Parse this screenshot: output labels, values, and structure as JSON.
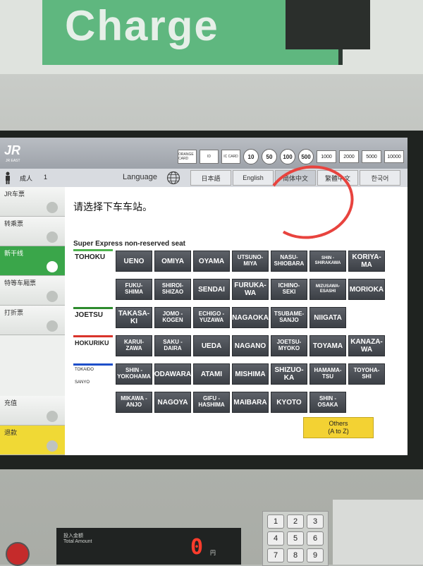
{
  "sign": {
    "text": "Charge"
  },
  "topbar": {
    "logo": "JR",
    "logo_sub": "JR EAST",
    "payment": {
      "cards": [
        "ORANGE CARD",
        "ID",
        "IC CARD"
      ],
      "coins": [
        "10",
        "50",
        "100",
        "500"
      ],
      "notes": [
        "1000",
        "2000",
        "5000",
        "10000"
      ]
    }
  },
  "langbar": {
    "passenger_label": "成人",
    "passenger_count": "1",
    "language_label": "Language",
    "tabs": [
      "日本語",
      "English",
      "简体中文",
      "繁體中文",
      "한국어"
    ]
  },
  "sidebar": {
    "items": [
      {
        "label": "JR车票",
        "state": "normal"
      },
      {
        "label": "转乘票",
        "state": "normal"
      },
      {
        "label": "新干线",
        "state": "active"
      },
      {
        "label": "特等车厢票",
        "state": "normal"
      },
      {
        "label": "打折票",
        "state": "normal"
      },
      {
        "label": "充值",
        "state": "normal"
      },
      {
        "label": "退款",
        "state": "highlight"
      }
    ]
  },
  "main": {
    "prompt": "请选择下车车站。",
    "seat_type": "Super Express non-reserved seat",
    "lines": [
      {
        "name": "TOHOKU",
        "color": "#4db34d"
      },
      {
        "name": "JOETSU",
        "color": "#2e8b2e"
      },
      {
        "name": "HOKURIKU",
        "color": "#d9342b"
      },
      {
        "name": "TOKAIDO",
        "color": "#1e4fc9"
      },
      {
        "name": "SANYO",
        "color": "#1e4fc9"
      }
    ],
    "stations": [
      [
        "UENO",
        "OMIYA",
        "OYAMA",
        "UTSUNO-\nMIYA",
        "NASU-\nSHIOBARA",
        "SHIN -\nSHIRAKAWA",
        "KORIYA-\nMA"
      ],
      [
        "FUKU-\nSHIMA",
        "SHIROI-\nSHIZAO",
        "SENDAI",
        "FURUKA-\nWA",
        "ICHINO-\nSEKI",
        "MIZUSAWA-\nESASHI",
        "MORIOKA"
      ],
      [
        "TAKASA-\nKI",
        "JOMO -\nKOGEN",
        "ECHIGO -\nYUZAWA",
        "NAGAOKA",
        "TSUBAME-\nSANJO",
        "NIIGATA"
      ],
      [
        "KARUI-\nZAWA",
        "SAKU -\nDAIRA",
        "UEDA",
        "NAGANO",
        "JOETSU-\nMYOKO",
        "TOYAMA",
        "KANAZA-\nWA"
      ],
      [
        "SHIN -\nYOKOHAMA",
        "ODAWARA",
        "ATAMI",
        "MISHIMA",
        "SHIZUO-\nKA",
        "HAMAMA-\nTSU",
        "TOYOHA-\nSHI"
      ],
      [
        "MIKAWA -\nANJO",
        "NAGOYA",
        "GIFU -\nHASHIMA",
        "MAIBARA",
        "KYOTO",
        "SHIN -\nOSAKA"
      ]
    ],
    "others": "Others\n(A to Z)"
  },
  "bottom": {
    "amount_label": "投入金額\nTotal Amount",
    "amount_value": "0",
    "amount_unit": "円",
    "keypad": [
      "1",
      "2",
      "3",
      "4",
      "5",
      "6",
      "7",
      "8",
      "9"
    ]
  },
  "colors": {
    "annotation": "#e8433e",
    "active": "#3aa64a",
    "highlight": "#f0d935",
    "amount": "#ff3c2c"
  }
}
